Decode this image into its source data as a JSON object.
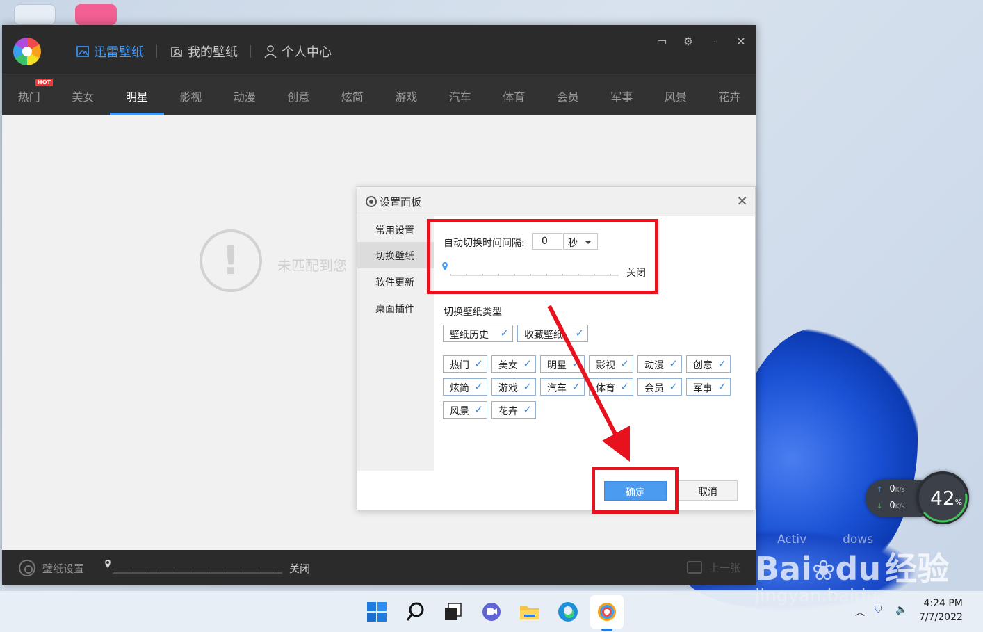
{
  "app": {
    "top_tabs": [
      "迅雷壁纸",
      "我的壁纸",
      "个人中心"
    ],
    "categories": [
      "热门",
      "美女",
      "明星",
      "影视",
      "动漫",
      "创意",
      "炫简",
      "游戏",
      "汽车",
      "体育",
      "会员",
      "军事",
      "风景",
      "花卉"
    ],
    "active_category": "明星",
    "hot_badge": "HOT",
    "empty_message": "未匹配到您",
    "bottom": {
      "settings_label": "壁纸设置",
      "off_label": "关闭",
      "prev_label": "上一张"
    }
  },
  "dialog": {
    "title": "设置面板",
    "close": "✕",
    "sidebar": [
      "常用设置",
      "切换壁纸",
      "软件更新",
      "桌面插件"
    ],
    "active_sidebar": "切换壁纸",
    "interval_label": "自动切换时间间隔:",
    "interval_value": "0",
    "interval_unit": "秒",
    "slider_off": "关闭",
    "type_label": "切换壁纸类型",
    "sources": [
      "壁纸历史",
      "收藏壁纸"
    ],
    "types": [
      "热门",
      "美女",
      "明星",
      "影视",
      "动漫",
      "创意",
      "炫简",
      "游戏",
      "汽车",
      "体育",
      "会员",
      "军事",
      "风景",
      "花卉"
    ],
    "ok": "确定",
    "cancel": "取消"
  },
  "widget": {
    "up_speed": "0",
    "down_speed": "0",
    "unit": "K/s",
    "cpu": "42",
    "cpu_unit": "%"
  },
  "overlay": {
    "activation": "Activ",
    "activation_end": "dows",
    "baidu_brand": "Bai",
    "baidu_du": "du",
    "baidu_jingyan": "经验",
    "baidu_url": "jingyan.baidu.com"
  },
  "taskbar": {
    "time": "4:24 PM",
    "date": "7/7/2022",
    "icons": [
      "start-icon",
      "search-icon",
      "task-view-icon",
      "chat-icon",
      "file-explorer-icon",
      "edge-icon",
      "wallpaper-app-icon"
    ]
  },
  "colors": {
    "accent": "#3d9bff",
    "annotation": "#e8121f",
    "ok_button": "#4b9cf0"
  }
}
